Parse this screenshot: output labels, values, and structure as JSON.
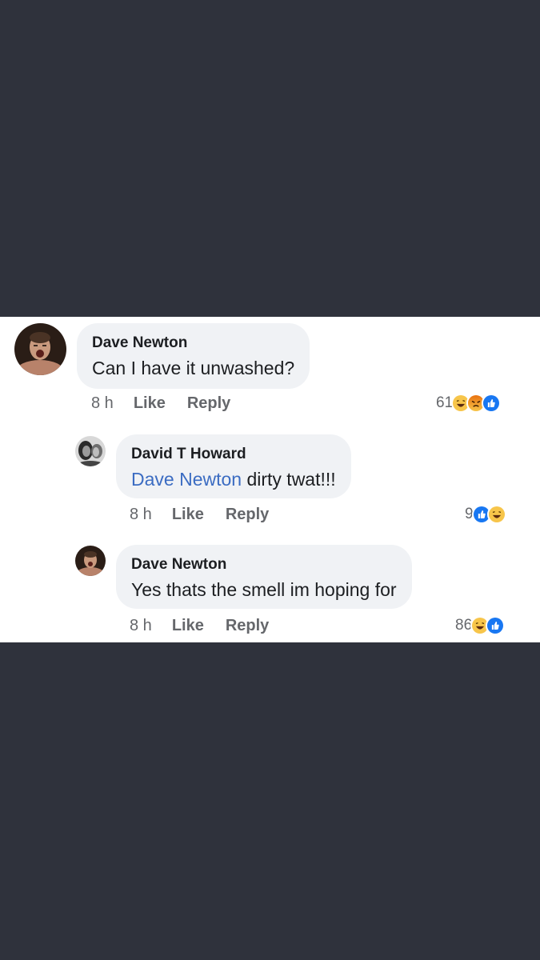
{
  "comments": [
    {
      "author": "Dave Newton",
      "text": "Can I have it unwashed?",
      "mention": "",
      "time": "8 h",
      "like": "Like",
      "reply": "Reply",
      "reaction_count": "61",
      "reactions": [
        "haha",
        "angry",
        "like"
      ]
    },
    {
      "author": "David T Howard",
      "mention": "Dave Newton",
      "text": " dirty twat!!!",
      "time": "8 h",
      "like": "Like",
      "reply": "Reply",
      "reaction_count": "9",
      "reactions": [
        "like",
        "haha"
      ]
    },
    {
      "author": "Dave Newton",
      "text": "Yes thats the smell im hoping for",
      "mention": "",
      "time": "8 h",
      "like": "Like",
      "reply": "Reply",
      "reaction_count": "86",
      "reactions": [
        "haha",
        "like"
      ]
    }
  ],
  "colors": {
    "background": "#2f323c",
    "panel": "#ffffff",
    "bubble": "#f0f2f5",
    "mention": "#3b6cc2",
    "meta": "#65676b",
    "like_blue": "#1877f2",
    "haha_yellow": "#f7c54a",
    "angry_orange": "#e9710f"
  }
}
